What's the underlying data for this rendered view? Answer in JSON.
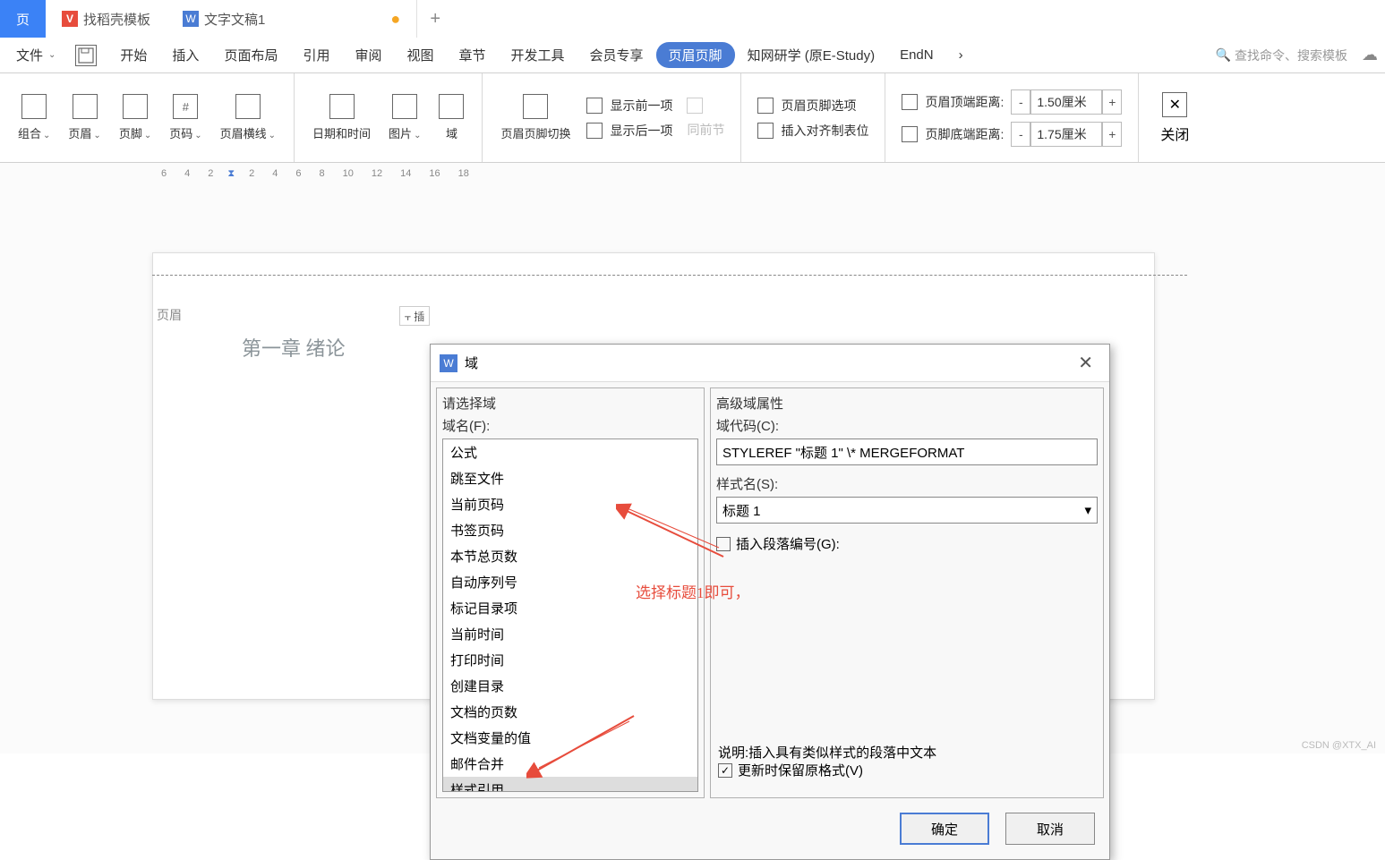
{
  "tabs": {
    "home": "页",
    "docer": "找稻壳模板",
    "doc": "文字文稿1",
    "add": "+"
  },
  "menubar": {
    "file": "文件",
    "items": [
      "开始",
      "插入",
      "页面布局",
      "引用",
      "审阅",
      "视图",
      "章节",
      "开发工具",
      "会员专享",
      "页眉页脚",
      "知网研学 (原E-Study)",
      "EndN"
    ],
    "more": "›",
    "search_placeholder": "查找命令、搜索模板"
  },
  "ribbon": {
    "combo": "组合",
    "header": "页眉",
    "footer": "页脚",
    "pagenum": "页码",
    "header_line": "页眉横线",
    "datetime": "日期和时间",
    "picture": "图片",
    "field": "域",
    "switch": "页眉页脚切换",
    "show_prev": "显示前一项",
    "show_next": "显示后一项",
    "same_section": "同前节",
    "hf_options": "页眉页脚选项",
    "insert_align": "插入对齐制表位",
    "header_top_label": "页眉顶端距离:",
    "header_top_val": "1.50厘米",
    "footer_bottom_label": "页脚底端距离:",
    "footer_bottom_val": "1.75厘米",
    "close": "关闭"
  },
  "ruler_ticks": [
    "6",
    "4",
    "2",
    "2",
    "4",
    "6",
    "8",
    "10",
    "12",
    "14",
    "16",
    "18"
  ],
  "doc": {
    "header_label": "页眉",
    "header_text": "第一章  绪论",
    "insert_btn": "⫟ 插"
  },
  "dialog": {
    "title": "域",
    "left_title": "请选择域",
    "field_name_label": "域名(F):",
    "fields": [
      "公式",
      "跳至文件",
      "当前页码",
      "书签页码",
      "本节总页数",
      "自动序列号",
      "标记目录项",
      "当前时间",
      "打印时间",
      "创建目录",
      "文档的页数",
      "文档变量的值",
      "邮件合并",
      "样式引用"
    ],
    "selected_field": "样式引用",
    "right_title": "高级域属性",
    "code_label": "域代码(C):",
    "code_value": "STYLEREF \"标题 1\" \\* MERGEFORMAT",
    "style_label": "样式名(S):",
    "style_value": "标题 1",
    "insert_para_num": "插入段落编号(G):",
    "desc": "说明:插入具有类似样式的段落中文本",
    "update_preserve": "更新时保留原格式(V)",
    "ok": "确定",
    "cancel": "取消"
  },
  "annotations": {
    "select_heading": "选择标题1即可，"
  },
  "watermark": "CSDN @XTX_AI"
}
